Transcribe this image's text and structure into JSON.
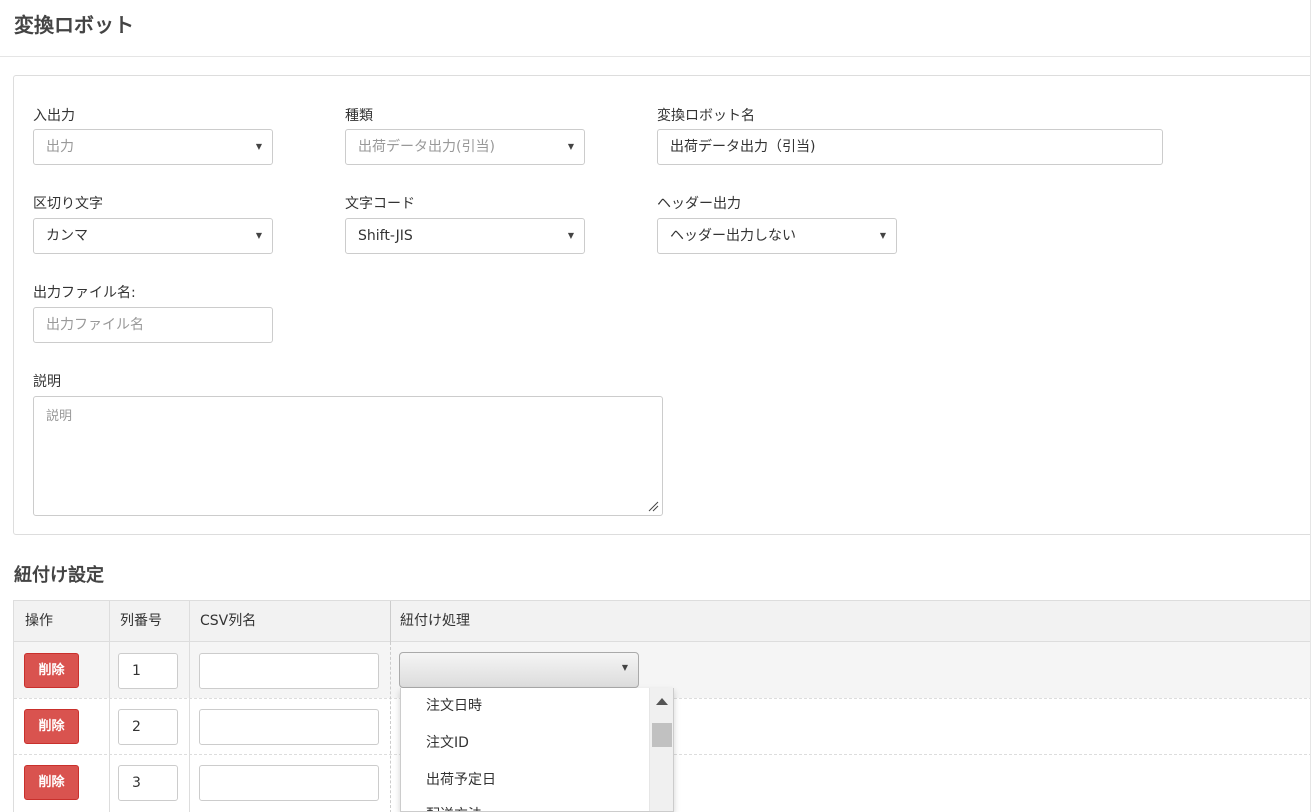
{
  "page": {
    "title": "変換ロボット"
  },
  "form": {
    "io": {
      "label": "入出力",
      "value": "出力"
    },
    "kind": {
      "label": "種類",
      "value": "出荷データ出力(引当)"
    },
    "robot_name": {
      "label": "変換ロボット名",
      "value": "出荷データ出力（引当)"
    },
    "delimiter": {
      "label": "区切り文字",
      "value": "カンマ"
    },
    "charcode": {
      "label": "文字コード",
      "value": "Shift-JIS"
    },
    "header_output": {
      "label": "ヘッダー出力",
      "value": "ヘッダー出力しない"
    },
    "output_filename": {
      "label": "出力ファイル名:",
      "placeholder": "出力ファイル名"
    },
    "description": {
      "label": "説明",
      "placeholder": "説明"
    }
  },
  "mapping": {
    "title": "紐付け設定",
    "columns": [
      "操作",
      "列番号",
      "CSV列名",
      "紐付け処理"
    ],
    "delete_label": "削除",
    "rows": [
      {
        "num": "1",
        "csv_name": ""
      },
      {
        "num": "2",
        "csv_name": ""
      },
      {
        "num": "3",
        "csv_name": ""
      }
    ],
    "link_select_value": "",
    "dropdown_options": [
      "注文日時",
      "注文ID",
      "出荷予定日",
      "配送方法"
    ]
  }
}
